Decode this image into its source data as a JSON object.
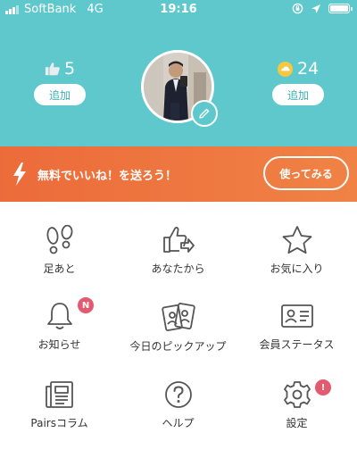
{
  "status_bar": {
    "carrier": "SoftBank",
    "network": "4G",
    "time": "19:16"
  },
  "profile": {
    "likes_count": "5",
    "likes_add_label": "追加",
    "points_count": "24",
    "points_add_label": "追加"
  },
  "banner": {
    "text": "無料でいいね！を送ろう！",
    "button_label": "使ってみる"
  },
  "menu": {
    "items": [
      {
        "label": "足あと",
        "icon": "footprints-icon"
      },
      {
        "label": "あなたから",
        "icon": "thumbs-up-arrow-icon"
      },
      {
        "label": "お気に入り",
        "icon": "star-icon"
      },
      {
        "label": "お知らせ",
        "icon": "bell-icon",
        "badge": "N"
      },
      {
        "label": "今日のピックアップ",
        "icon": "pickup-cards-icon"
      },
      {
        "label": "会員ステータス",
        "icon": "id-card-icon"
      },
      {
        "label": "Pairsコラム",
        "icon": "newspaper-icon"
      },
      {
        "label": "ヘルプ",
        "icon": "help-icon"
      },
      {
        "label": "設定",
        "icon": "gear-icon",
        "badge": "!"
      }
    ]
  },
  "colors": {
    "header": "#5ec8cc",
    "banner": "#ec6b3a",
    "badge": "#e5596f",
    "icon": "#555555"
  }
}
